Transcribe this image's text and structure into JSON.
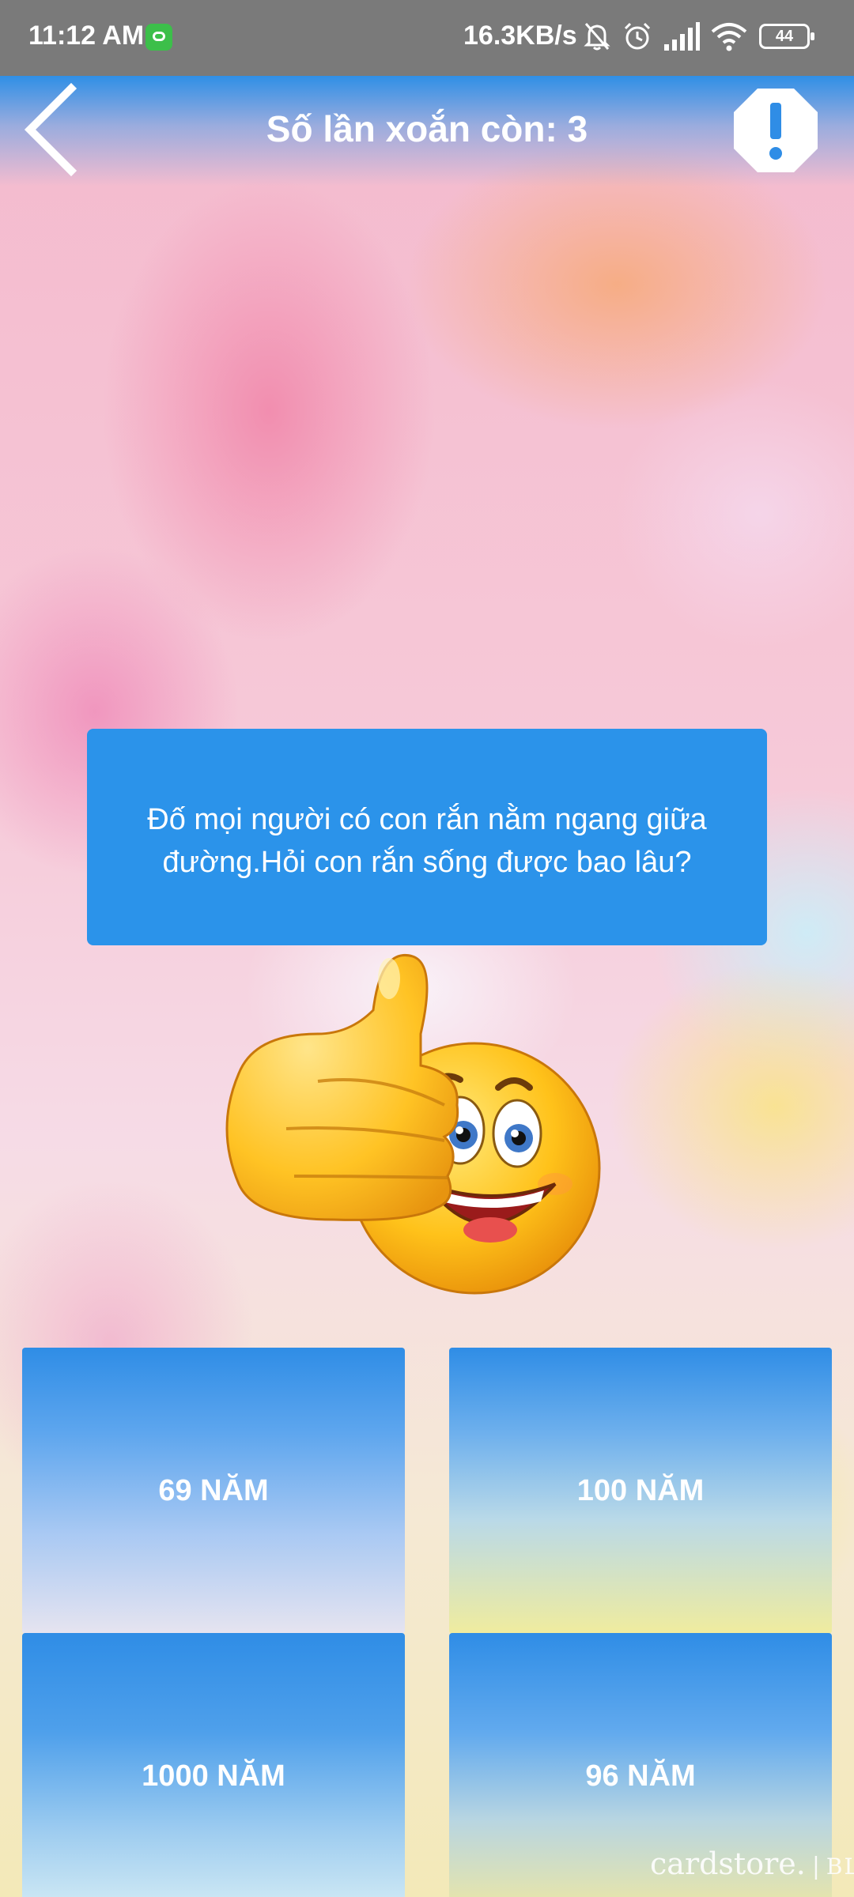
{
  "status_bar": {
    "time": "11:12 AM",
    "network_speed": "16.3KB/s",
    "battery": "44",
    "icons": [
      "app-notification-icon",
      "mute-bell-icon",
      "alarm-icon",
      "signal-icon",
      "wifi-icon",
      "battery-icon"
    ]
  },
  "header": {
    "title": "Số lần xoắn còn: 3",
    "back_icon": "chevron-left-icon",
    "alert_icon": "exclamation-octagon-icon"
  },
  "question": {
    "text": "Đố mọi người có con rắn nằm ngang giữa đường.Hỏi con rắn sống được bao lâu?"
  },
  "emoji": "thumbs-up-smiley",
  "answers": [
    {
      "label": "69 NĂM"
    },
    {
      "label": "100 NĂM"
    },
    {
      "label": "1000 NĂM"
    },
    {
      "label": "96 NĂM"
    }
  ],
  "watermark": {
    "brand": "cardstore.",
    "suffix": "BLOG"
  },
  "colors": {
    "accent": "#2b93ea",
    "status_bar": "#7a7a7a",
    "text_on_accent": "#ffffff"
  }
}
